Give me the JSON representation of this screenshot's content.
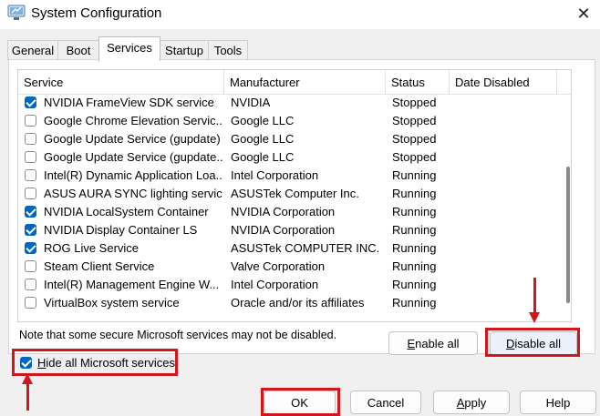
{
  "window": {
    "title": "System Configuration",
    "app_icon": "system-config-icon",
    "close_glyph": "✕"
  },
  "tabs": [
    {
      "label": "General",
      "active": false
    },
    {
      "label": "Boot",
      "active": false
    },
    {
      "label": "Services",
      "active": true
    },
    {
      "label": "Startup",
      "active": false
    },
    {
      "label": "Tools",
      "active": false
    }
  ],
  "table": {
    "columns": [
      "Service",
      "Manufacturer",
      "Status",
      "Date Disabled"
    ],
    "rows": [
      {
        "checked": true,
        "service": "NVIDIA FrameView SDK service",
        "manufacturer": "NVIDIA",
        "status": "Stopped"
      },
      {
        "checked": false,
        "service": "Google Chrome Elevation Servic...",
        "manufacturer": "Google LLC",
        "status": "Stopped"
      },
      {
        "checked": false,
        "service": "Google Update Service (gupdate)",
        "manufacturer": "Google LLC",
        "status": "Stopped"
      },
      {
        "checked": false,
        "service": "Google Update Service (gupdate...",
        "manufacturer": "Google LLC",
        "status": "Stopped"
      },
      {
        "checked": false,
        "service": "Intel(R) Dynamic Application Loa...",
        "manufacturer": "Intel Corporation",
        "status": "Running"
      },
      {
        "checked": false,
        "service": "ASUS AURA SYNC lighting service",
        "manufacturer": "ASUSTek Computer Inc.",
        "status": "Running"
      },
      {
        "checked": true,
        "service": "NVIDIA LocalSystem Container",
        "manufacturer": "NVIDIA Corporation",
        "status": "Running"
      },
      {
        "checked": true,
        "service": "NVIDIA Display Container LS",
        "manufacturer": "NVIDIA Corporation",
        "status": "Running"
      },
      {
        "checked": true,
        "service": "ROG Live Service",
        "manufacturer": "ASUSTek COMPUTER INC.",
        "status": "Running"
      },
      {
        "checked": false,
        "service": "Steam Client Service",
        "manufacturer": "Valve Corporation",
        "status": "Running"
      },
      {
        "checked": false,
        "service": "Intel(R) Management Engine W...",
        "manufacturer": "Intel Corporation",
        "status": "Running"
      },
      {
        "checked": false,
        "service": "VirtualBox system service",
        "manufacturer": "Oracle and/or its affiliates",
        "status": "Running"
      }
    ]
  },
  "note": "Note that some secure Microsoft services may not be disabled.",
  "buttons": {
    "enable_all": {
      "mnemonic": "E",
      "rest": "nable all"
    },
    "disable_all": {
      "mnemonic": "D",
      "rest": "isable all"
    },
    "ok": "OK",
    "cancel": "Cancel",
    "apply": {
      "mnemonic": "A",
      "rest": "pply"
    },
    "help": "Help"
  },
  "hide_ms": {
    "checked": true,
    "mnemonic": "H",
    "rest": "ide all Microsoft services"
  },
  "annotation_color": "#d3161d",
  "accent_color": "#0067c0"
}
